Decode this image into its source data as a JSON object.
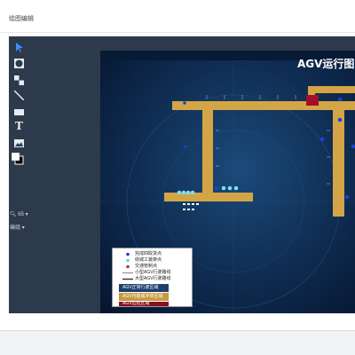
{
  "header": {
    "title": "绘图编辑"
  },
  "toolbar": {
    "tools": [
      {
        "name": "select",
        "icon": "cursor-arrow-icon"
      },
      {
        "name": "ellipse",
        "icon": "ellipse-icon"
      },
      {
        "name": "pattern",
        "icon": "checker-pattern-icon"
      },
      {
        "name": "line",
        "icon": "line-icon"
      },
      {
        "name": "rectangle",
        "icon": "rectangle-icon"
      },
      {
        "name": "text",
        "icon": "text-icon",
        "glyph": "T"
      },
      {
        "name": "image",
        "icon": "image-icon"
      },
      {
        "name": "colors",
        "icon": "color-swatch-icon"
      }
    ],
    "zoom_label": "65",
    "layer_label": "编组"
  },
  "canvas": {
    "title": "AGV运行图",
    "colors": {
      "track": "#d4a546",
      "background": "#0b2242",
      "dot": "#1b3fd8",
      "station": "#7ee0f0",
      "red_block": "#a0102a"
    }
  },
  "legend": {
    "rows": [
      {
        "label": "完成四取货点",
        "symbol": "blue-dot",
        "color": "#1b3fd8"
      },
      {
        "label": "绕城工装架点",
        "symbol": "cyan-dot",
        "color": "#5ad7ee"
      },
      {
        "label": "交通管制点",
        "symbol": "red-dot",
        "color": "#d42a2a"
      },
      {
        "label": "小型AGV行驶路线",
        "symbol": "thin-line",
        "color": "#333333"
      },
      {
        "label": "大型AGV行驶路线",
        "symbol": "thick-line",
        "color": "#333333"
      }
    ],
    "boxes": [
      {
        "label": "AGV正常行驶区域",
        "color": "#1e3f6e"
      },
      {
        "label": "AGV可能或冲突区域",
        "color": "#c79a3f"
      },
      {
        "label": "AGV危险区域",
        "color": "#8a1020"
      }
    ]
  }
}
